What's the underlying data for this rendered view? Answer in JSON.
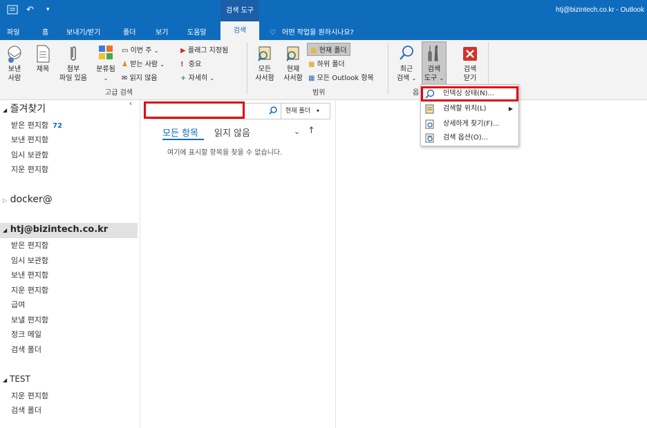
{
  "titlebar": {
    "context_tab": "검색 도구",
    "window_title": "htj@bizintech.co.kr  -  Outlook"
  },
  "tabs": [
    "파일",
    "홈",
    "보내기/받기",
    "폴더",
    "보기",
    "도움말"
  ],
  "active_tab": "검색",
  "tell_me": "어떤 작업을 원하시나요?",
  "ribbon": {
    "from": "보낸\n사람",
    "subject": "제목",
    "has_attachment": "첨부\n파일 있음",
    "categorized": "분류됨",
    "this_week": "이번 주",
    "sent_to": "받는 사람",
    "unread": "읽지 않음",
    "flagged": "플래그 지정됨",
    "important": "중요",
    "more": "자세히",
    "refine_group": "고급 검색",
    "all_mailboxes": "모든\n사서함",
    "current_mailbox": "현재\n사서함",
    "current_folder": "현재 폴더",
    "subfolders": "하위 폴더",
    "all_outlook_items": "모든 Outlook 항목",
    "scope_group": "범위",
    "recent_searches": "최근\n검색",
    "search_tools": "검색\n도구",
    "close_search": "검색\n닫기",
    "options_group_partial": "옵"
  },
  "nav": {
    "favorites": "즐겨찾기",
    "fav_items": [
      {
        "label": "받은 편지함",
        "count": "72"
      },
      {
        "label": "보낸 편지함"
      },
      {
        "label": "임시 보관함"
      },
      {
        "label": "지운 편지함"
      }
    ],
    "account1": "docker@",
    "account2": "htj@bizintech.co.kr",
    "acct2_items": [
      "받은 편지함",
      "임시 보관함",
      "보낸 편지함",
      "지운 편지함",
      "급여",
      "보낼 편지함",
      "정크 메일",
      "검색 폴더"
    ],
    "account3": "TEST",
    "acct3_items": [
      "지운 편지함",
      "검색 폴더"
    ]
  },
  "list": {
    "search_value": "",
    "scope": "현재 폴더",
    "filter_all": "모든 항목",
    "filter_unread": "읽지 않음",
    "empty": "여기에 표시할 항목을 찾을 수 없습니다."
  },
  "menu": {
    "indexing_status": "인덱싱 상태(N)...",
    "locations": "검색할 위치(L)",
    "advanced_find": "상세하게 찾기(F)...",
    "search_options": "검색 옵션(O)..."
  },
  "colors": {
    "brand": "#0f6cbd",
    "highlight": "#e3000f"
  }
}
